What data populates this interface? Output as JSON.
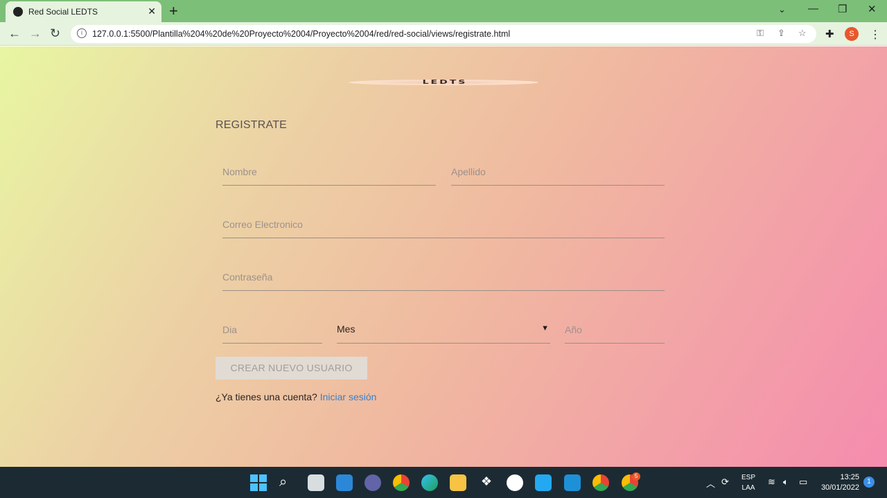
{
  "browser": {
    "tab_title": "Red Social LEDTS",
    "url": "127.0.0.1:5500/Plantilla%204%20de%20Proyecto%2004/Proyecto%2004/red/red-social/views/registrate.html",
    "profile_initial": "S"
  },
  "page": {
    "logo_text": "LEDTS",
    "heading": "REGISTRATE",
    "fields": {
      "nombre": "Nombre",
      "apellido": "Apellido",
      "correo": "Correo Electronico",
      "contrasena": "Contraseña",
      "dia": "Dia",
      "mes": "Mes",
      "anio": "Año"
    },
    "submit_label": "CREAR NUEVO USUARIO",
    "login_prompt": "¿Ya tienes una cuenta?",
    "login_link": "Iniciar sesión"
  },
  "taskbar": {
    "lang_top": "ESP",
    "lang_bottom": "LAA",
    "time": "13:25",
    "date": "30/01/2022",
    "notification_count": "1",
    "chrome_badge": "5"
  },
  "colors": {
    "gradient_start": "#e8f6a2",
    "gradient_end": "#f58cae",
    "link": "#3b80c8",
    "tabbar": "#7cbf78"
  }
}
